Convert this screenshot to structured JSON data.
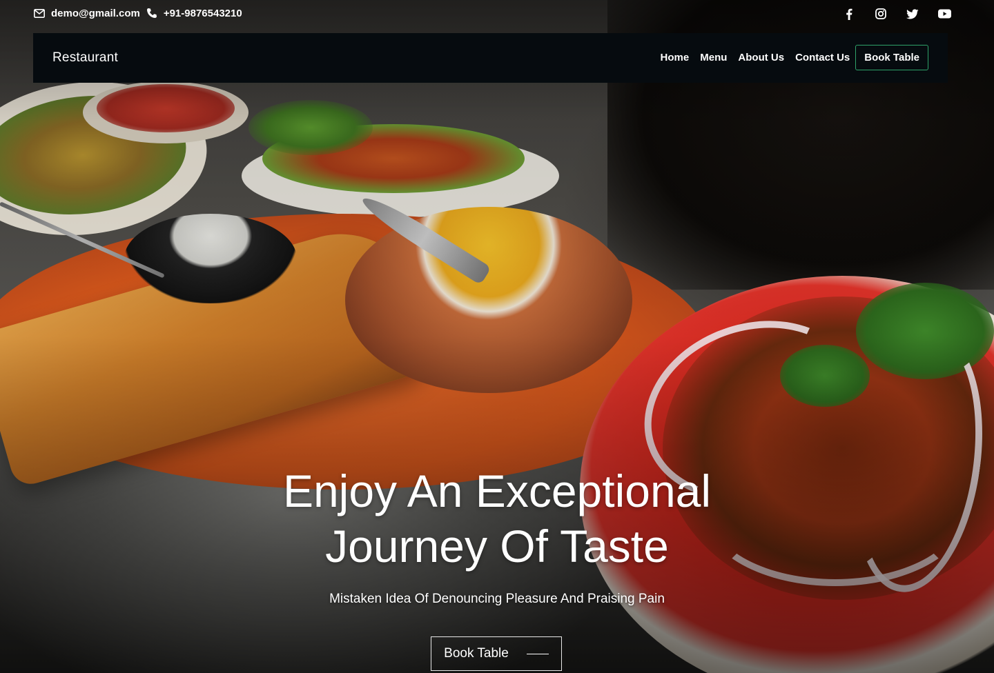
{
  "topbar": {
    "email": "demo@gmail.com",
    "phone": "+91-9876543210",
    "icons": [
      "mail-icon",
      "phone-icon"
    ],
    "socials": [
      "facebook-icon",
      "instagram-icon",
      "twitter-icon",
      "youtube-icon"
    ]
  },
  "navbar": {
    "brand": "Restaurant",
    "links": [
      "Home",
      "Menu",
      "About Us",
      "Contact Us"
    ],
    "cta": "Book Table",
    "cta_border_color": "#2fa36a",
    "background": "#060b0f"
  },
  "hero": {
    "title_line1": "Enjoy An Exceptional",
    "title_line2": "Journey Of Taste",
    "subtitle": "Mistaken Idea Of Denouncing Pleasure And Praising Pain",
    "button": "Book Table"
  }
}
